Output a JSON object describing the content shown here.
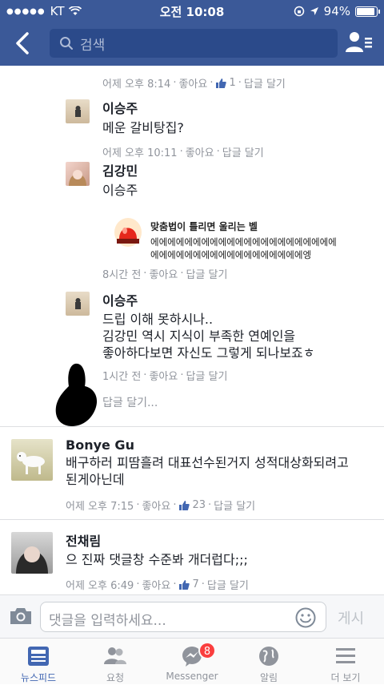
{
  "status_bar": {
    "carrier": "KT",
    "time": "오전 10:08",
    "battery": "94%",
    "battery_level": 0.94
  },
  "header": {
    "search_placeholder": "검색"
  },
  "comments": [
    {
      "meta": {
        "time": "어제 오후 8:14",
        "like": "좋아요",
        "likes": "1",
        "reply": "답글 달기"
      }
    },
    {
      "name": "이승주",
      "text": "메운 갈비탕집?",
      "meta": {
        "time": "어제 오후 10:11",
        "like": "좋아요",
        "reply": "답글 달기"
      }
    },
    {
      "name": "김강민",
      "text": "이승주",
      "sticker": {
        "title": "맞춤법이 틀리면 울리는 벨",
        "line1": "에에에에에에에에에에에에에에에에에에에에에에",
        "line2": "에에에에에에에에에에에에에에에에에에엥"
      },
      "meta": {
        "time": "8시간 전",
        "like": "좋아요",
        "reply": "답글 달기"
      }
    },
    {
      "name": "이승주",
      "text_lines": [
        "드립 이해 못하시나..",
        "김강민  역시 지식이 부족한 연예인을",
        "좋아하다보면 자신도 그렇게 되나보죠ㅎ"
      ],
      "meta": {
        "time": "1시간 전",
        "like": "좋아요",
        "reply": "답글 달기"
      }
    },
    {
      "reply_prompt": "답글 달기..."
    },
    {
      "name": "Bonye Gu",
      "text_lines": [
        "배구하러 피땀흘려 대표선수된거지 성적대상화되려고",
        "된게아닌데"
      ],
      "meta": {
        "time": "어제 오후 7:15",
        "like": "좋아요",
        "likes": "23",
        "reply": "답글 달기"
      }
    },
    {
      "name": "전채림",
      "text": "으 진짜 댓글창 수준봐 개더럽다;;;",
      "meta": {
        "time": "어제 오후 6:49",
        "like": "좋아요",
        "likes": "7",
        "reply": "답글 달기"
      }
    }
  ],
  "composer": {
    "placeholder": "댓글을 입력하세요...",
    "post_label": "게시"
  },
  "tabs": [
    {
      "label": "뉴스피드",
      "active": true
    },
    {
      "label": "요청"
    },
    {
      "label": "Messenger",
      "badge": "8"
    },
    {
      "label": "알림"
    },
    {
      "label": "더 보기"
    }
  ],
  "colors": {
    "brand": "#3b5998",
    "meta_gray": "#90949c",
    "badge_red": "#fa3e3e",
    "active_tab": "#4267b2"
  }
}
